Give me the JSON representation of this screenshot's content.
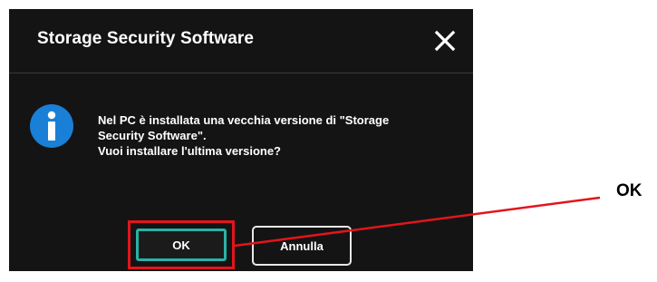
{
  "dialog": {
    "title": "Storage Security Software",
    "message_lines": [
      "Nel PC è installata una vecchia versione di \"Storage",
      "Security Software\".",
      "Vuoi installare l'ultima versione?"
    ],
    "icons": {
      "close": "close-icon",
      "info": "info-icon"
    },
    "buttons": {
      "ok": "OK",
      "cancel": "Annulla"
    }
  },
  "annotation": {
    "label": "OK",
    "color": "#e2151b"
  },
  "colors": {
    "dialog_background": "#141414",
    "info_icon": "#1a7fd6",
    "ok_focus_border": "#2ab1a6",
    "highlight_box": "#e2151b"
  }
}
